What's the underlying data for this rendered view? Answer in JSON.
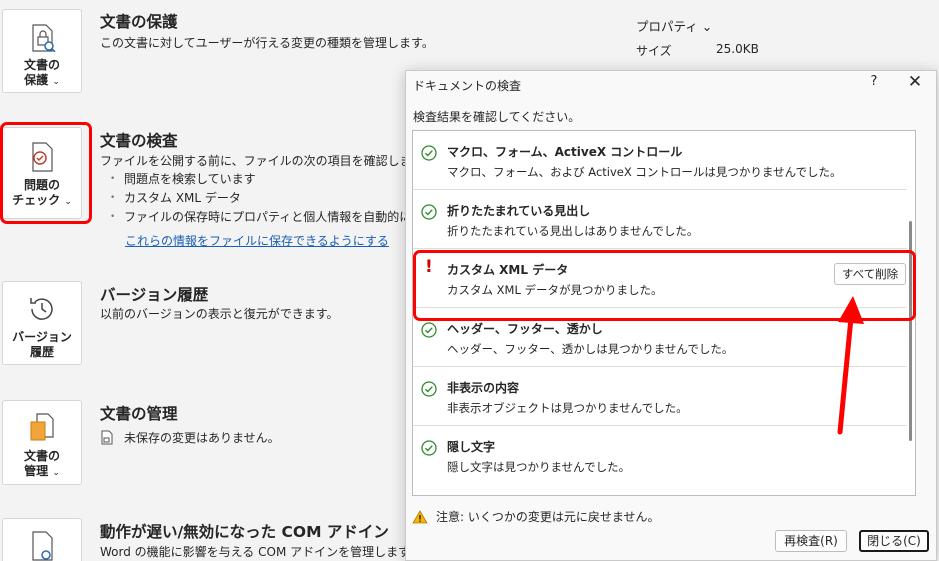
{
  "backstage": {
    "protect": {
      "tile_line1": "文書の",
      "tile_line2": "保護",
      "chevron": "⌄",
      "title": "文書の保護",
      "desc": "この文書に対してユーザーが行える変更の種類を管理します。"
    },
    "inspect": {
      "tile_line1": "問題の",
      "tile_line2": "チェック",
      "chevron": "⌄",
      "title": "文書の検査",
      "desc": "ファイルを公開する前に、ファイルの次の項目を確認します。",
      "bullets": [
        "問題点を検索しています",
        "カスタム XML データ",
        "ファイルの保存時にプロパティと個人情報を自動的に削除す"
      ],
      "link": "これらの情報をファイルに保存できるようにする"
    },
    "version": {
      "tile_line1": "バージョン",
      "tile_line2": "履歴",
      "title": "バージョン履歴",
      "desc": "以前のバージョンの表示と復元ができます。"
    },
    "manage": {
      "tile_line1": "文書の",
      "tile_line2": "管理",
      "chevron": "⌄",
      "title": "文書の管理",
      "desc": "未保存の変更はありません。"
    },
    "com": {
      "title": "動作が遅い/無効になった COM アドイン",
      "desc": "Word の機能に影響を与える COM アドインを管理します。"
    },
    "properties": {
      "title": "プロパティ ⌄",
      "size_label": "サイズ",
      "size_value": "25.0KB"
    }
  },
  "dialog": {
    "title": "ドキュメントの検査",
    "help": "?",
    "close": "✕",
    "instruction": "検査結果を確認してください。",
    "items": [
      {
        "title": "マクロ、フォーム、ActiveX コントロール",
        "desc": "マクロ、フォーム、および ActiveX コントロールは見つかりませんでした。",
        "status": "ok"
      },
      {
        "title": "折りたたまれている見出し",
        "desc": "折りたたまれている見出しはありませんでした。",
        "status": "ok"
      },
      {
        "title": "カスタム XML データ",
        "desc": "カスタム XML データが見つかりました。",
        "status": "found"
      },
      {
        "title": "ヘッダー、フッター、透かし",
        "desc": "ヘッダー、フッター、透かしは見つかりませんでした。",
        "status": "ok"
      },
      {
        "title": "非表示の内容",
        "desc": "非表示オブジェクトは見つかりませんでした。",
        "status": "ok"
      },
      {
        "title": "隠し文字",
        "desc": "隠し文字は見つかりませんでした。",
        "status": "ok"
      }
    ],
    "remove_all": "すべて削除",
    "warning": "注意: いくつかの変更は元に戻せません。",
    "reinspect": "再検査(R)",
    "close_button": "閉じる(C)"
  },
  "colors": {
    "ok_green": "#2e8b2e",
    "warn_red": "#d40000",
    "highlight": "#ff0000",
    "link": "#1a5fb4"
  }
}
